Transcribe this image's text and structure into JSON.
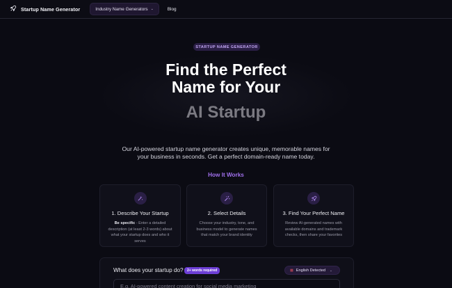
{
  "nav": {
    "brand": "Startup Name Generator",
    "dropdown": "Industry Name Generators",
    "blog": "Blog"
  },
  "hero": {
    "badge": "STARTUP NAME GENERATOR",
    "title_line1": "Find the Perfect",
    "title_line2": "Name for Your",
    "title_accent": "AI Startup",
    "desc_line1": "Our AI-powered startup name generator creates unique, memorable names for",
    "desc_line2": "your business in seconds. Get a perfect domain-ready name today."
  },
  "how": {
    "heading": "How It Works",
    "cards": [
      {
        "icon": "sparkle-wand-icon",
        "title": "1. Describe Your Startup",
        "strong": "Be specific",
        "body": " - Enter a detailed description (at least 2-3 words) about what your startup does and who it serves"
      },
      {
        "icon": "magic-wand-icon",
        "title": "2. Select Details",
        "body": "Choose your industry, tone, and business model to generate names that match your brand identity"
      },
      {
        "icon": "rocket-icon",
        "title": "3. Find Your Perfect Name",
        "body": "Review AI-generated names with available domains and trademark checks, then share your favorites"
      }
    ]
  },
  "form": {
    "question": "What does your startup do?",
    "required_badge": "2+ words required",
    "language": "English Detected",
    "placeholder": "E.g. AI-powered content creation for social media marketing"
  },
  "colors": {
    "background": "#0b0b13",
    "accent": "#a070ec",
    "badge_bg": "#2a1e45",
    "required_bg": "#6d3fd6"
  }
}
